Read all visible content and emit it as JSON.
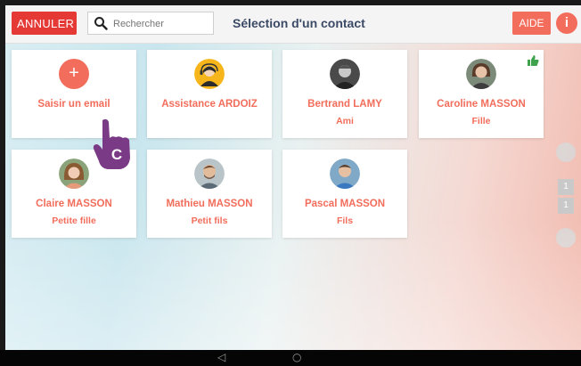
{
  "header": {
    "cancel_label": "ANNULER",
    "search_placeholder": "Rechercher",
    "title": "Sélection d'un contact",
    "help_label": "AIDE",
    "info_label": "i"
  },
  "add_card": {
    "label": "Saisir un email",
    "plus": "+"
  },
  "contacts": [
    {
      "name": "Assistance ARDOIZ",
      "relation": ""
    },
    {
      "name": "Bertrand LAMY",
      "relation": "Ami"
    },
    {
      "name": "Caroline MASSON",
      "relation": "Fille",
      "badge": "thumbs-up-icon"
    },
    {
      "name": "Claire MASSON",
      "relation": "Petite fille"
    },
    {
      "name": "Mathieu MASSON",
      "relation": "Petit fils"
    },
    {
      "name": "Pascal MASSON",
      "relation": "Fils"
    }
  ],
  "pager": {
    "pages": [
      "1",
      "1"
    ]
  },
  "cursor": {
    "letter": "C"
  },
  "nav": {
    "back": "◁",
    "home": "○"
  },
  "colors": {
    "accent": "#f26d5b",
    "cancel": "#e53935",
    "title": "#3b4a66"
  }
}
